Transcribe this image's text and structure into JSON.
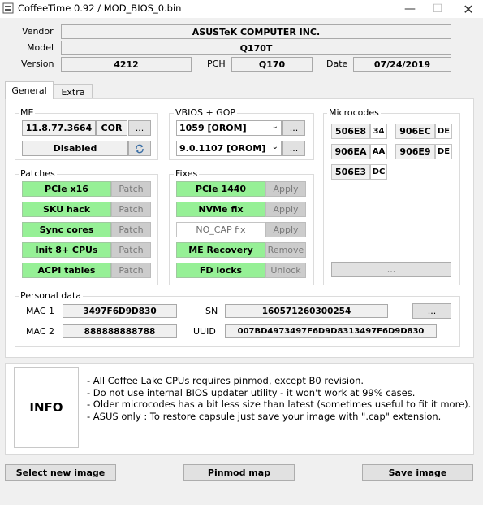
{
  "window": {
    "title": "CoffeeTime 0.92  /  MOD_BIOS_0.bin"
  },
  "header": {
    "vendor_label": "Vendor",
    "vendor": "ASUSTeK COMPUTER INC.",
    "model_label": "Model",
    "model": "Q170T",
    "version_label": "Version",
    "version": "4212",
    "pch_label": "PCH",
    "pch": "Q170",
    "date_label": "Date",
    "date": "07/24/2019"
  },
  "tabs": [
    {
      "label": "General",
      "active": true
    },
    {
      "label": "Extra",
      "active": false
    }
  ],
  "me": {
    "label": "ME",
    "version": "11.8.77.3664",
    "type": "COR",
    "browse": "...",
    "state": "Disabled"
  },
  "vbios": {
    "label": "VBIOS + GOP",
    "vbios": "1059 [OROM]",
    "gop": "9.0.1107 [OROM]",
    "browse1": "...",
    "browse2": "..."
  },
  "microcodes": {
    "label": "Microcodes",
    "items": [
      {
        "id": "506E8",
        "ver": "34"
      },
      {
        "id": "906EC",
        "ver": "DE"
      },
      {
        "id": "906EA",
        "ver": "AA"
      },
      {
        "id": "906E9",
        "ver": "DE"
      },
      {
        "id": "506E3",
        "ver": "DC"
      }
    ],
    "browse": "..."
  },
  "patches": {
    "label": "Patches",
    "items": [
      {
        "name": "PCIe x16",
        "action": "Patch"
      },
      {
        "name": "SKU hack",
        "action": "Patch"
      },
      {
        "name": "Sync cores",
        "action": "Patch"
      },
      {
        "name": "Init 8+ CPUs",
        "action": "Patch"
      },
      {
        "name": "ACPI tables",
        "action": "Patch"
      }
    ]
  },
  "fixes": {
    "label": "Fixes",
    "items": [
      {
        "name": "PCIe 1440",
        "action": "Apply"
      },
      {
        "name": "NVMe fix",
        "action": "Apply"
      },
      {
        "name": "NO_CAP fix",
        "action": "Apply"
      },
      {
        "name": "ME Recovery",
        "action": "Remove"
      },
      {
        "name": "FD locks",
        "action": "Unlock"
      }
    ]
  },
  "personal": {
    "label": "Personal data",
    "mac1_label": "MAC 1",
    "mac1": "3497F6D9D830",
    "mac2_label": "MAC 2",
    "mac2": "888888888788",
    "sn_label": "SN",
    "sn": "160571260300254",
    "uuid_label": "UUID",
    "uuid": "007BD4973497F6D9D8313497F6D9D830",
    "browse": "..."
  },
  "info": {
    "title": "INFO",
    "lines": [
      "- All Coffee Lake CPUs requires pinmod, except B0 revision.",
      "- Do not use internal BIOS updater utility - it won't work at 99% cases.",
      "- Older microcodes has a bit less size than latest (sometimes useful to fit it more).",
      "",
      "- ASUS only : To restore capsule just save your image with \".cap\" extension."
    ]
  },
  "footer": {
    "select": "Select new image",
    "pinmod": "Pinmod map",
    "save": "Save image"
  }
}
